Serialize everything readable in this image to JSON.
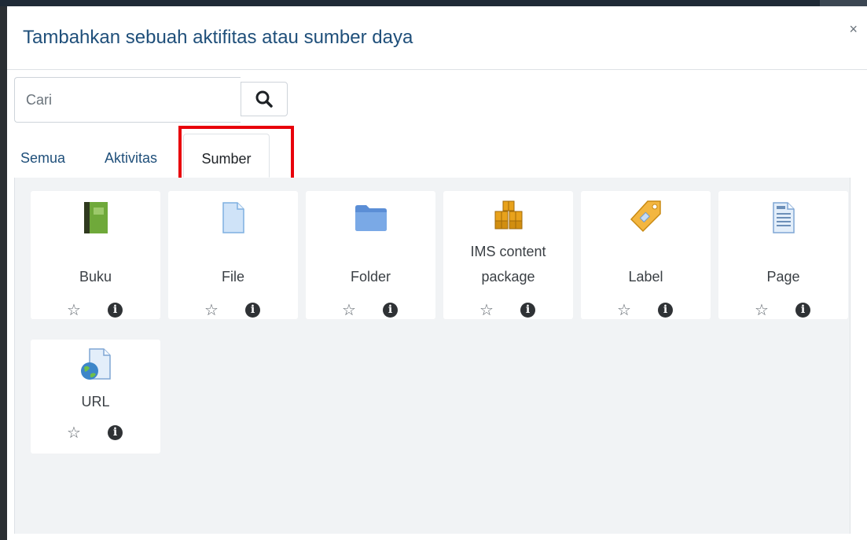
{
  "dialog": {
    "title": "Tambahkan sebuah aktifitas atau sumber daya",
    "close_label": "×"
  },
  "search": {
    "placeholder": "Cari",
    "button_icon": "search-icon"
  },
  "tabs": [
    {
      "label": "Semua",
      "active": false
    },
    {
      "label": "Aktivitas",
      "active": false
    },
    {
      "label": "Sumber",
      "active": true
    }
  ],
  "highlight_color": "#e8000b",
  "items": [
    {
      "label_lines": [
        "Buku"
      ],
      "icon": "book-icon"
    },
    {
      "label_lines": [
        "File"
      ],
      "icon": "file-icon"
    },
    {
      "label_lines": [
        "Folder"
      ],
      "icon": "folder-icon"
    },
    {
      "label_lines": [
        "IMS content",
        "package"
      ],
      "icon": "package-icon"
    },
    {
      "label_lines": [
        "Label"
      ],
      "icon": "label-tag-icon"
    },
    {
      "label_lines": [
        "Page"
      ],
      "icon": "page-icon"
    },
    {
      "label_lines": [
        "URL"
      ],
      "icon": "url-globe-icon"
    }
  ],
  "item_actions": {
    "star": "☆",
    "info": "i"
  },
  "colors": {
    "title": "#1f4f7a",
    "link": "#1f4f7a",
    "panel_bg": "#f1f3f5"
  }
}
